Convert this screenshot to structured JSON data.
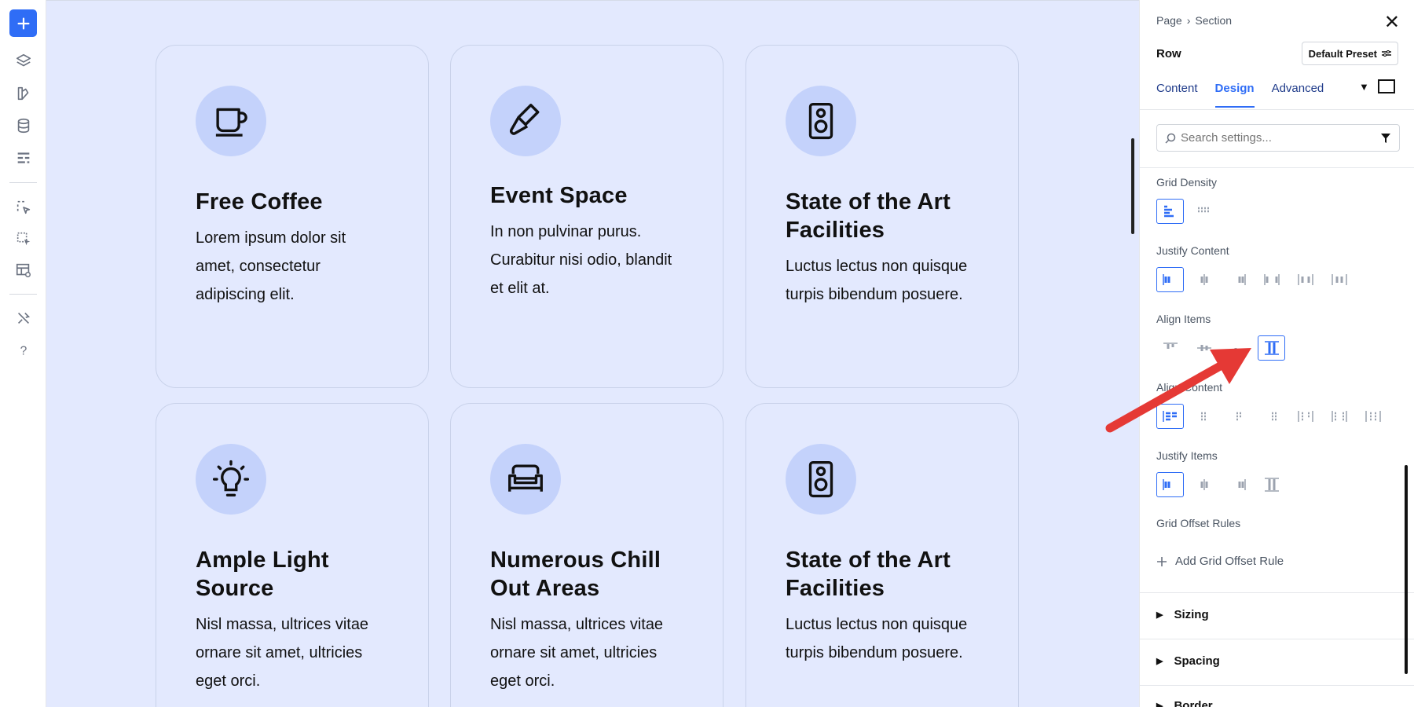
{
  "toolbar": {
    "icons": [
      "plus-icon",
      "layers-icon",
      "palette-icon",
      "database-icon",
      "layout-icon",
      "cursor-select-icon",
      "multi-select-icon",
      "preview-icon",
      "tools-icon",
      "help-icon"
    ]
  },
  "cards": [
    {
      "title": "Free Coffee",
      "body": "Lorem ipsum dolor sit amet, consectetur adipiscing elit.",
      "icon": "coffee-cup-icon"
    },
    {
      "title": "Event Space",
      "body": "In non pulvinar purus. Curabitur nisi odio, blandit et elit at.",
      "icon": "microphone-icon"
    },
    {
      "title": "State of the Art Facilities",
      "body": "Luctus lectus non quisque turpis bibendum posuere.",
      "icon": "speaker-icon"
    },
    {
      "title": "Ample Light Source",
      "body": "Nisl massa, ultrices vitae ornare sit amet, ultricies eget orci.",
      "icon": "light-bulb-icon"
    },
    {
      "title": "Numerous Chill Out Areas",
      "body": "Nisl massa, ultrices vitae ornare sit amet, ultricies eget orci.",
      "icon": "sofa-icon"
    },
    {
      "title": "State of the Art Facilities",
      "body": "Luctus lectus non quisque turpis bibendum posuere.",
      "icon": "speaker-icon"
    }
  ],
  "panel": {
    "breadcrumb": {
      "page": "Page",
      "sep": "›",
      "section": "Section"
    },
    "element": "Row",
    "preset_label": "Default Preset",
    "tabs": [
      "Content",
      "Design",
      "Advanced"
    ],
    "active_tab": "Design",
    "search_placeholder": "Search settings...",
    "groups": {
      "grid_density": "Grid Density",
      "justify_content": "Justify Content",
      "align_items": "Align Items",
      "align_content": "Align Content",
      "justify_items": "Justify Items",
      "grid_offset_rules": "Grid Offset Rules"
    },
    "add_rule_label": "Add Grid Offset Rule",
    "sections": [
      "Sizing",
      "Spacing",
      "Border"
    ]
  },
  "colors": {
    "accent": "#2f6df6",
    "canvas_bg": "#e3e9fe",
    "icon_bg": "#c4d2fb",
    "arrow": "#e53935"
  }
}
